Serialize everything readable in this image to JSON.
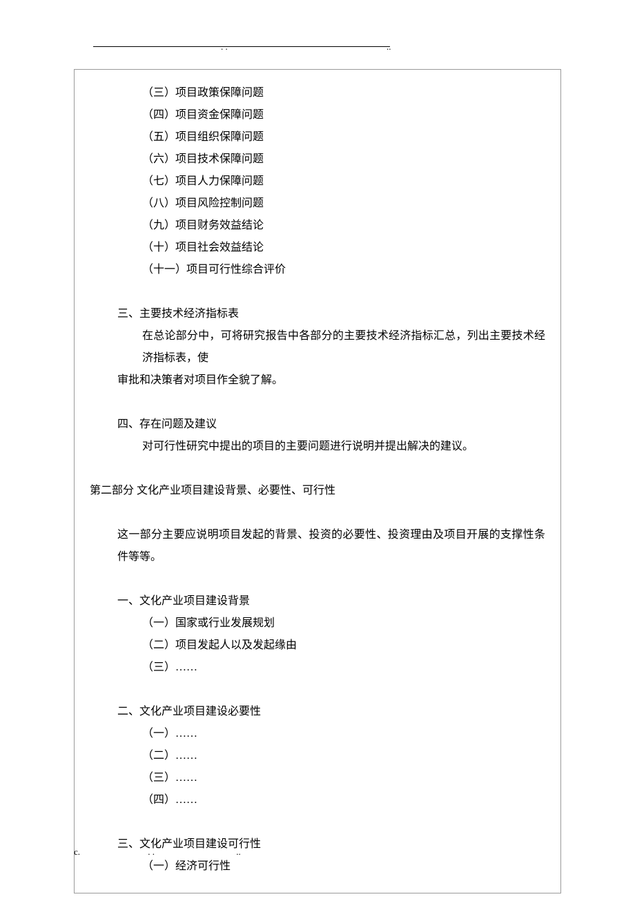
{
  "header": {
    "dots1": ". .",
    "dots2": ".."
  },
  "list1": {
    "item3": "（三）项目政策保障问题",
    "item4": "（四）项目资金保障问题",
    "item5": "（五）项目组织保障问题",
    "item6": "（六）项目技术保障问题",
    "item7": "（七）项目人力保障问题",
    "item8": "（八）项目风险控制问题",
    "item9": "（九）项目财务效益结论",
    "item10": "（十）项目社会效益结论",
    "item11": "（十一）项目可行性综合评价"
  },
  "section3": {
    "title": "三、主要技术经济指标表",
    "para1": "在总论部分中，可将研究报告中各部分的主要技术经济指标汇总，列出主要技术经济指标表，使",
    "para2": "审批和决策者对项目作全貌了解。"
  },
  "section4": {
    "title": "四、存在问题及建议",
    "para1": "对可行性研究中提出的项目的主要问题进行说明并提出解决的建议。"
  },
  "part2": {
    "title": "第二部分 文化产业项目建设背景、必要性、可行性",
    "intro": "这一部分主要应说明项目发起的背景、投资的必要性、投资理由及项目开展的支撑性条件等等。"
  },
  "p2s1": {
    "title": "一、文化产业项目建设背景",
    "item1": "（一）国家或行业发展规划",
    "item2": "（二）项目发起人以及发起缘由",
    "item3": "（三）……"
  },
  "p2s2": {
    "title": "二、文化产业项目建设必要性",
    "item1": "（一）……",
    "item2": "（二）……",
    "item3": "（三）……",
    "item4": "（四）……"
  },
  "p2s3": {
    "title": "三、文化产业项目建设可行性",
    "item1": "（一）经济可行性"
  },
  "footer": {
    "c": "c.",
    "dots1": ". .",
    "dots2": ".."
  }
}
